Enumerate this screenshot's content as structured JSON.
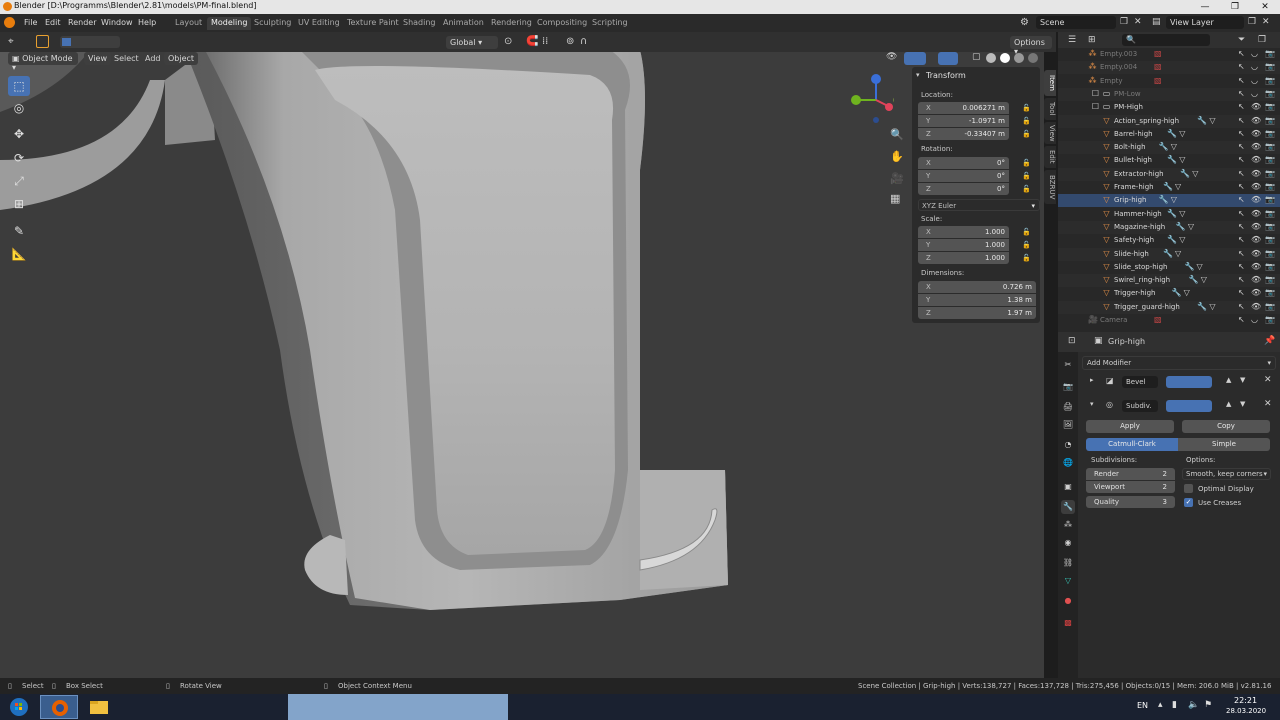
{
  "window": {
    "title": "Blender [D:\\Programms\\Blender\\2.81\\models\\PM-final.blend]",
    "minimize": "—",
    "maximize": "❐",
    "close": "✕"
  },
  "menubar": {
    "menus": [
      "File",
      "Edit",
      "Render",
      "Window",
      "Help"
    ],
    "workspaces": [
      "Layout",
      "Modeling",
      "Sculpting",
      "UV Editing",
      "Texture Paint",
      "Shading",
      "Animation",
      "Rendering",
      "Compositing",
      "Scripting"
    ],
    "active_workspace": "Modeling",
    "scene": "Scene",
    "view_layer": "View Layer"
  },
  "viewport_header": {
    "orientation": "Global",
    "options": "Options",
    "mode": "Object Mode",
    "menus": [
      "View",
      "Select",
      "Add",
      "Object"
    ]
  },
  "npanel": {
    "title": "Transform",
    "location_label": "Location:",
    "location": [
      {
        "axis": "X",
        "value": "0.006271 m"
      },
      {
        "axis": "Y",
        "value": "-1.0971 m"
      },
      {
        "axis": "Z",
        "value": "-0.33407 m"
      }
    ],
    "rotation_label": "Rotation:",
    "rotation": [
      {
        "axis": "X",
        "value": "0°"
      },
      {
        "axis": "Y",
        "value": "0°"
      },
      {
        "axis": "Z",
        "value": "0°"
      }
    ],
    "rotation_mode": "XYZ Euler",
    "scale_label": "Scale:",
    "scale": [
      {
        "axis": "X",
        "value": "1.000"
      },
      {
        "axis": "Y",
        "value": "1.000"
      },
      {
        "axis": "Z",
        "value": "1.000"
      }
    ],
    "dimensions_label": "Dimensions:",
    "dimensions": [
      {
        "axis": "X",
        "value": "0.726 m"
      },
      {
        "axis": "Y",
        "value": "1.38 m"
      },
      {
        "axis": "Z",
        "value": "1.97 m"
      }
    ],
    "side_tabs": [
      "Item",
      "Tool",
      "View",
      "Edit",
      "BZRUV"
    ]
  },
  "outliner": {
    "items": [
      {
        "name": "Empty.003",
        "type": "empty",
        "dim": true
      },
      {
        "name": "Empty.004",
        "type": "empty",
        "dim": true
      },
      {
        "name": "Empty",
        "type": "empty",
        "dim": true
      },
      {
        "name": "PM-Low",
        "type": "collection",
        "dim": true
      },
      {
        "name": "PM-High",
        "type": "collection",
        "dim": false
      },
      {
        "name": "Action_spring-high",
        "type": "mesh"
      },
      {
        "name": "Barrel-high",
        "type": "mesh"
      },
      {
        "name": "Bolt-high",
        "type": "mesh"
      },
      {
        "name": "Bullet-high",
        "type": "mesh"
      },
      {
        "name": "Extractor-high",
        "type": "mesh"
      },
      {
        "name": "Frame-high",
        "type": "mesh"
      },
      {
        "name": "Grip-high",
        "type": "mesh",
        "selected": true
      },
      {
        "name": "Hammer-high",
        "type": "mesh"
      },
      {
        "name": "Magazine-high",
        "type": "mesh"
      },
      {
        "name": "Safety-high",
        "type": "mesh"
      },
      {
        "name": "Slide-high",
        "type": "mesh"
      },
      {
        "name": "Slide_stop-high",
        "type": "mesh"
      },
      {
        "name": "Swirel_ring-high",
        "type": "mesh"
      },
      {
        "name": "Trigger-high",
        "type": "mesh"
      },
      {
        "name": "Trigger_guard-high",
        "type": "mesh"
      },
      {
        "name": "Camera",
        "type": "camera",
        "dim": true
      }
    ]
  },
  "properties": {
    "object_name": "Grip-high",
    "add_modifier": "Add Modifier",
    "modifiers": [
      {
        "name": "Bevel",
        "expanded": false
      },
      {
        "name": "Subdiv.",
        "expanded": true
      }
    ],
    "apply": "Apply",
    "copy": "Copy",
    "algorithms": [
      "Catmull-Clark",
      "Simple"
    ],
    "subdivisions_label": "Subdivisions:",
    "options_label": "Options:",
    "render_label": "Render",
    "render_value": "2",
    "viewport_label": "Viewport",
    "viewport_value": "2",
    "quality_label": "Quality",
    "quality_value": "3",
    "uv_smooth": "Smooth, keep corners",
    "optimal_display": "Optimal Display",
    "use_creases": "Use Creases"
  },
  "statusbar": {
    "select": "Select",
    "box_select": "Box Select",
    "rotate_view": "Rotate View",
    "context_menu": "Object Context Menu",
    "stats": "Scene Collection | Grip-high | Verts:138,727 | Faces:137,728 | Tris:275,456 | Objects:0/15 | Mem: 206.0 MiB | v2.81.16"
  },
  "taskbar": {
    "lang": "EN",
    "time": "22:21",
    "date": "28.03.2020"
  },
  "colors": {
    "accent": "#4772b3",
    "mesh_icon": "#e69148",
    "modifier_icon": "#39c7b9",
    "blender_orange": "#e87d0d"
  }
}
